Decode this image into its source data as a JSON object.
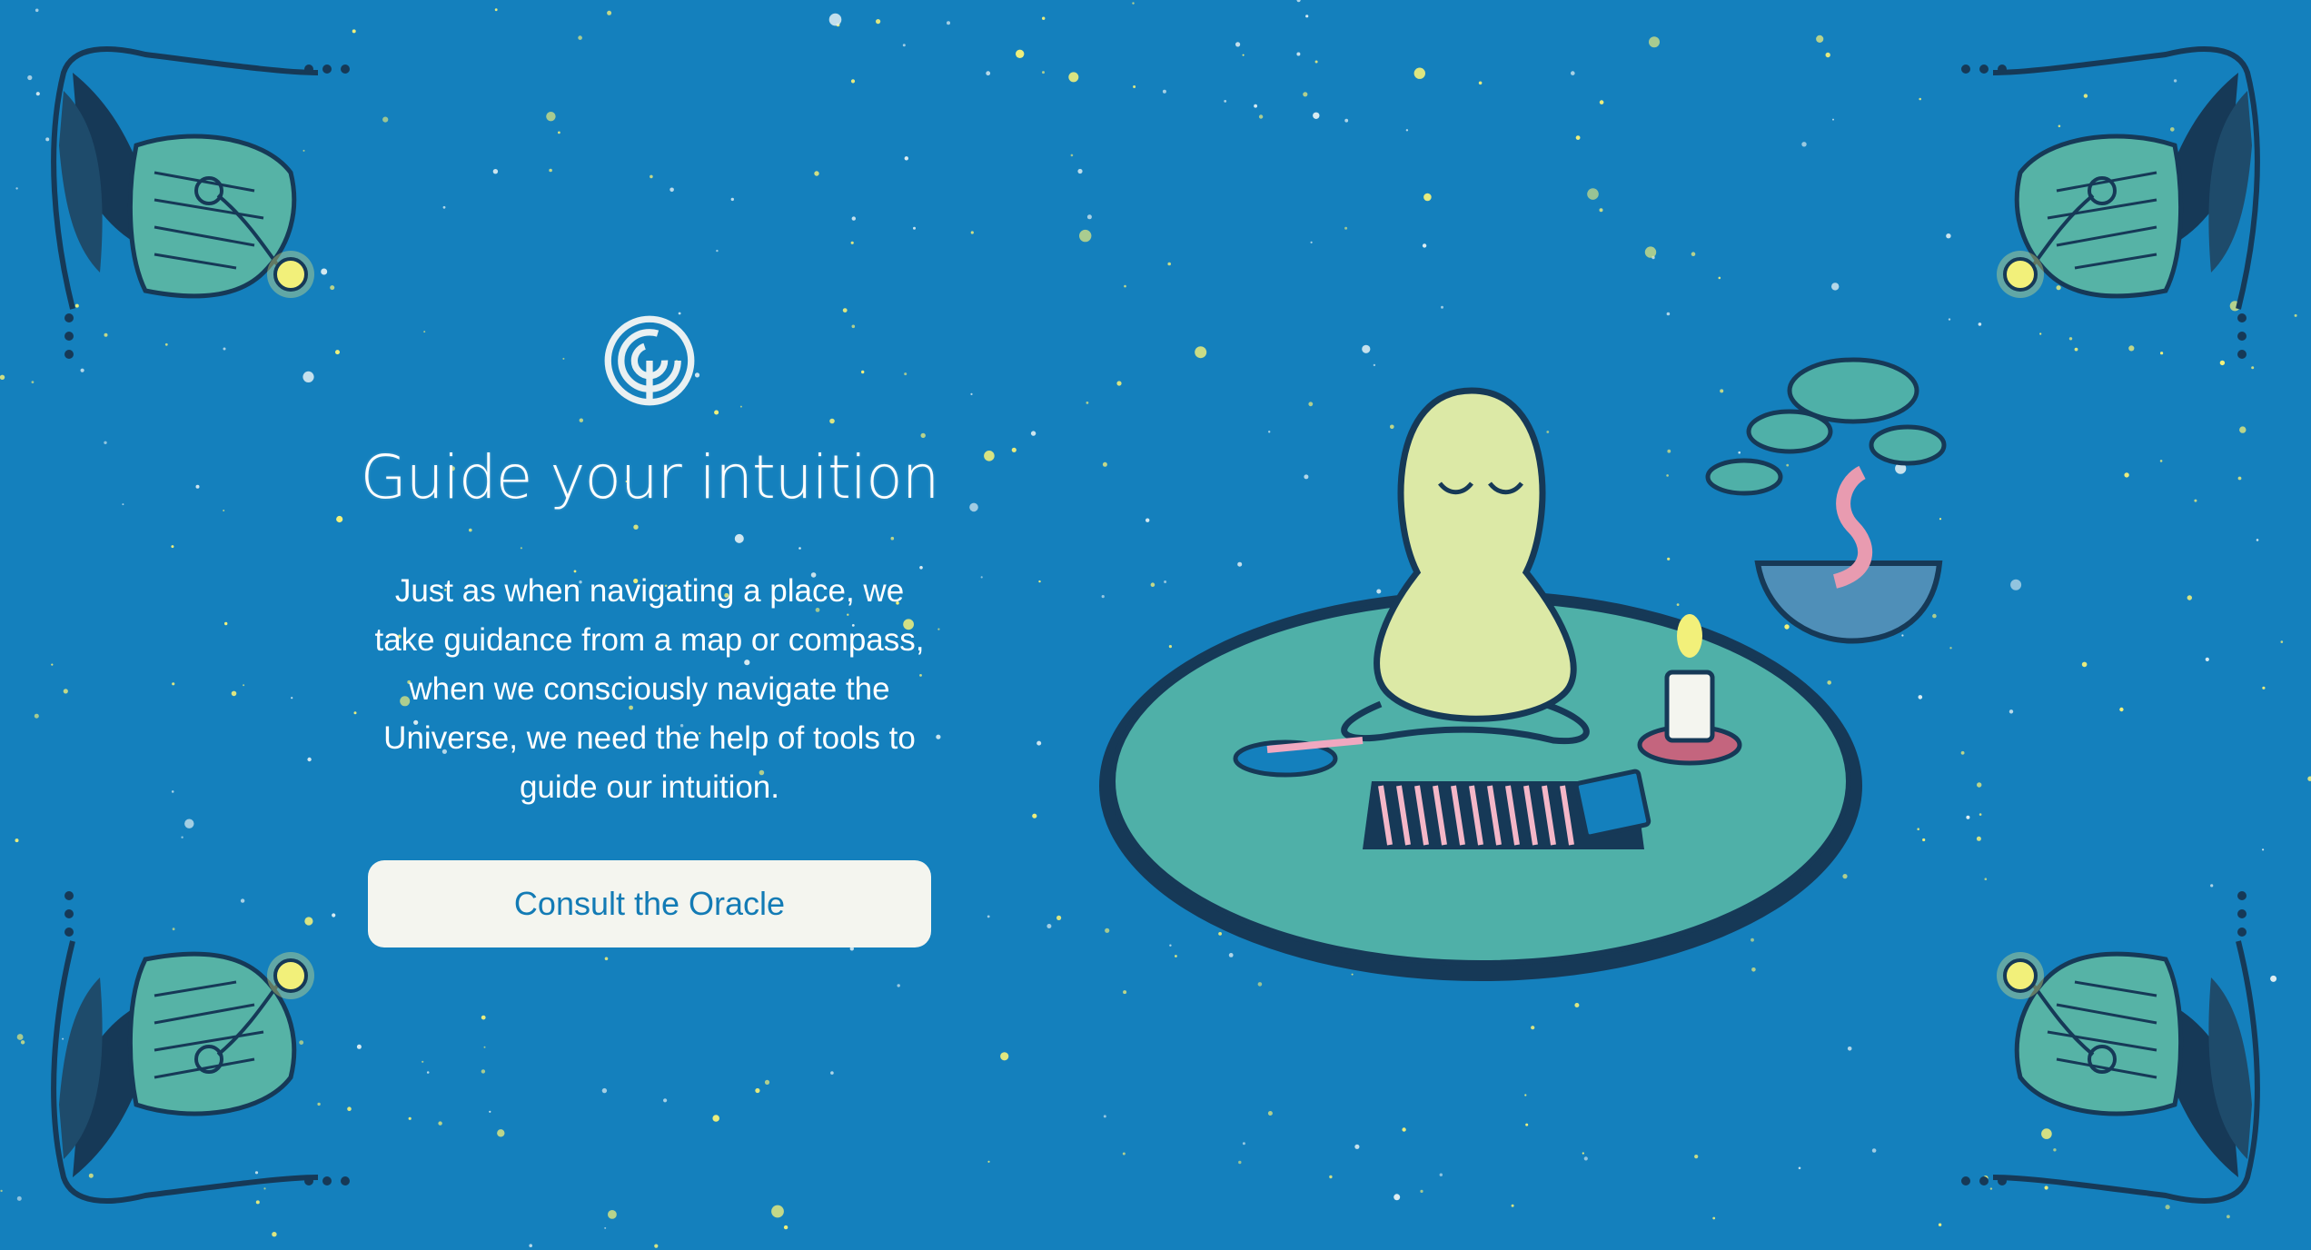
{
  "hero": {
    "logo_icon": "labyrinth-icon",
    "title": "Guide your intuition",
    "description": "Just as when navigating a place, we take guidance from a map or compass, when we consciously navigate the Universe, we need the help of tools to guide our intuition.",
    "cta_label": "Consult the Oracle"
  },
  "illustration": {
    "subject": "meditating-figure-icon",
    "items": [
      "tarot-cards-icon",
      "candle-icon",
      "incense-bowl-icon",
      "bonsai-tree-icon",
      "rug-icon"
    ]
  },
  "decor": {
    "corner_icon": "fern-leaf-icon",
    "lamp_icon": "glow-orb-icon"
  },
  "colors": {
    "background": "#1480bd",
    "star": "#f2f07a",
    "leaf": "#56b3a6",
    "leaf_dark": "#163957",
    "button_bg": "#f4f5ef",
    "button_text": "#137bb5",
    "figure": "#dce9a6",
    "rug": "#4fb0a8"
  }
}
